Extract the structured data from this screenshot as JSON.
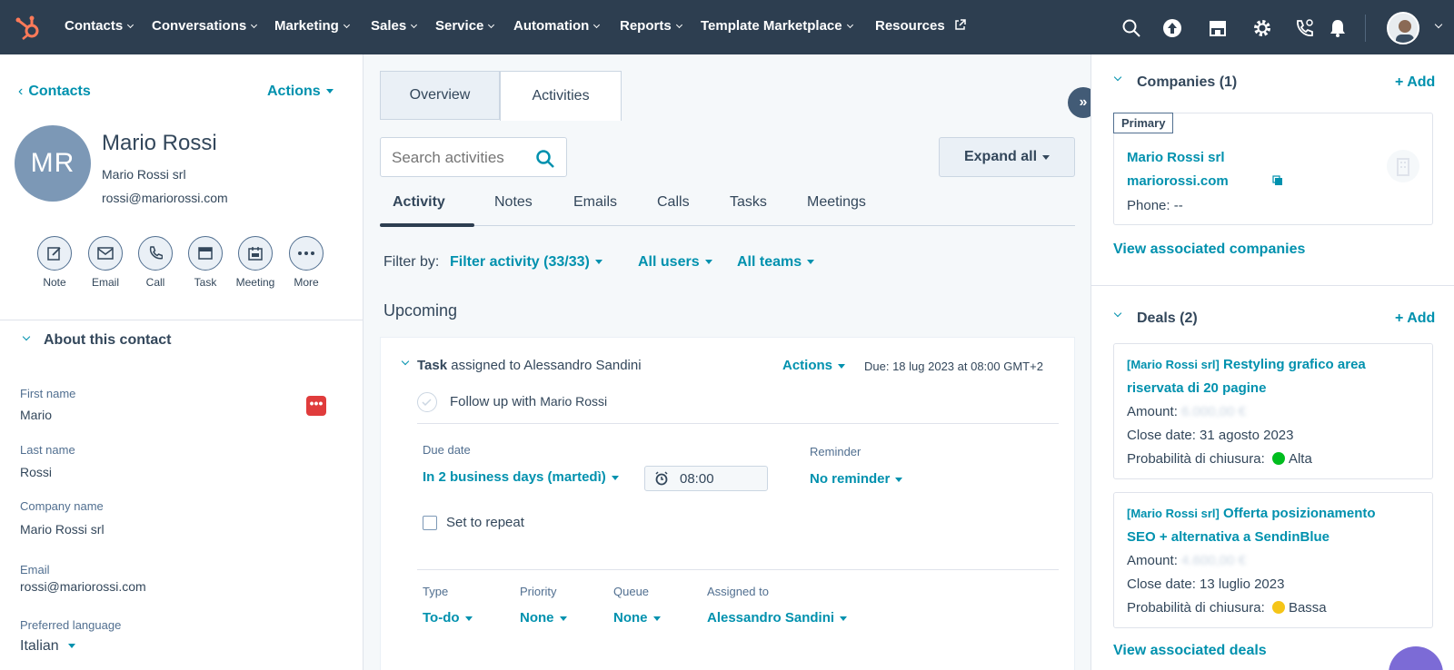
{
  "nav": {
    "items": [
      "Contacts",
      "Conversations",
      "Marketing",
      "Sales",
      "Service",
      "Automation",
      "Reports",
      "Template Marketplace",
      "Resources"
    ],
    "icons": [
      "search-icon",
      "upgrade-icon",
      "marketplace-icon",
      "settings-icon",
      "calling-icon",
      "notifications-icon"
    ]
  },
  "contact": {
    "back_label": "Contacts",
    "actions_label": "Actions",
    "initials": "MR",
    "name": "Mario Rossi",
    "company": "Mario Rossi srl",
    "email": "rossi@mariorossi.com",
    "quick_actions": [
      "Note",
      "Email",
      "Call",
      "Task",
      "Meeting",
      "More"
    ]
  },
  "about": {
    "title": "About this contact",
    "fields": [
      {
        "label": "First name",
        "value": "Mario"
      },
      {
        "label": "Last name",
        "value": "Rossi"
      },
      {
        "label": "Company name",
        "value": "Mario Rossi srl"
      },
      {
        "label": "Email",
        "value": "rossi@mariorossi.com"
      },
      {
        "label": "Preferred language",
        "value": "Italian"
      }
    ]
  },
  "center": {
    "tabs": [
      "Overview",
      "Activities"
    ],
    "search_placeholder": "Search activities",
    "expand_all": "Expand all",
    "subtabs": [
      "Activity",
      "Notes",
      "Emails",
      "Calls",
      "Tasks",
      "Meetings"
    ],
    "filter_label": "Filter by:",
    "filters": [
      "Filter activity (33/33)",
      "All users",
      "All teams"
    ],
    "upcoming": "Upcoming"
  },
  "task": {
    "type_label": "Task",
    "assigned_text": "assigned to Alessandro Sandini",
    "actions": "Actions",
    "due": "Due: 18 lug 2023 at 08:00 GMT+2",
    "followup_prefix": "Follow up with",
    "followup_name": "Mario Rossi",
    "due_date_label": "Due date",
    "due_date_value": "In 2 business days (martedì)",
    "time": "08:00",
    "reminder_label": "Reminder",
    "reminder_value": "No reminder",
    "repeat_label": "Set to repeat",
    "type_field_label": "Type",
    "type_field_value": "To-do",
    "priority_label": "Priority",
    "priority_value": "None",
    "queue_label": "Queue",
    "queue_value": "None",
    "assigned_label": "Assigned to",
    "assigned_value": "Alessandro Sandini"
  },
  "companies": {
    "title": "Companies (1)",
    "add": "+ Add",
    "primary": "Primary",
    "name": "Mario Rossi srl",
    "domain": "mariorossi.com",
    "phone": "Phone: --",
    "view_link": "View associated companies"
  },
  "deals": {
    "title": "Deals (2)",
    "add": "+ Add",
    "items": [
      {
        "prefix": "[Mario Rossi srl]",
        "name_line1": "Restyling grafico area",
        "name_line2": "riservata di 20 pagine",
        "amount_label": "Amount:",
        "amount": "6.000,00 €",
        "close": "Close date: 31 agosto 2023",
        "prob_label": "Probabilità di chiusura:",
        "prob": "Alta",
        "prob_color": "#00bd1e"
      },
      {
        "prefix": "[Mario Rossi srl]",
        "name_line1": "Offerta posizionamento",
        "name_line2": "SEO + alternativa a SendinBlue",
        "amount_label": "Amount:",
        "amount": "4.600,00 €",
        "close": "Close date: 13 luglio 2023",
        "prob_label": "Probabilità di chiusura:",
        "prob": "Bassa",
        "prob_color": "#f5c518"
      }
    ],
    "view_link": "View associated deals"
  },
  "colors": {
    "nav_bg": "#2d3e50",
    "link": "#0091ae",
    "logo": "#ff7a59"
  }
}
